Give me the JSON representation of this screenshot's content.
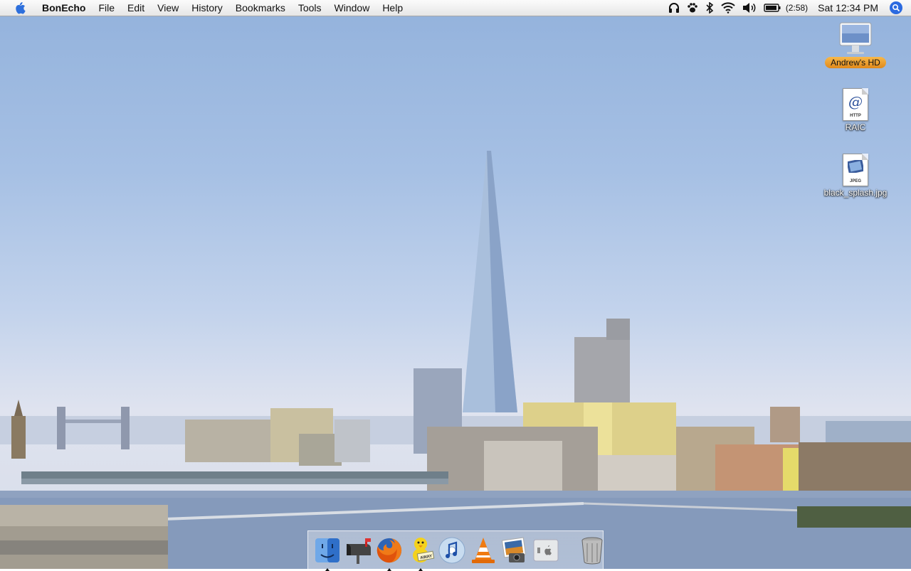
{
  "menubar": {
    "app_name": "BonEcho",
    "items": [
      "File",
      "Edit",
      "View",
      "History",
      "Bookmarks",
      "Tools",
      "Window",
      "Help"
    ],
    "battery_time": "(2:58)",
    "clock": "Sat 12:34 PM",
    "status_icons": [
      "headphones-icon",
      "growl-paw-icon",
      "bluetooth-icon",
      "wifi-icon",
      "volume-icon",
      "battery-icon"
    ]
  },
  "desktop": {
    "icons": [
      {
        "label": "Andrew's HD",
        "icon": "imac-icon",
        "selected": true
      },
      {
        "label": "RAIC",
        "icon": "http-location-icon",
        "badge": "HTTP"
      },
      {
        "label": "black_splash.jpg",
        "icon": "jpeg-file-icon",
        "badge": "JPEG"
      }
    ]
  },
  "dock": {
    "items": [
      {
        "icon": "finder-icon",
        "running": true
      },
      {
        "icon": "mail-icon",
        "running": false
      },
      {
        "icon": "firefox-icon",
        "running": true
      },
      {
        "icon": "adium-icon",
        "running": true,
        "badge": "AWAY"
      },
      {
        "icon": "itunes-icon",
        "running": false
      },
      {
        "icon": "vlc-icon",
        "running": false
      },
      {
        "icon": "iphoto-icon",
        "running": false
      },
      {
        "icon": "boot-camp-icon",
        "running": false
      },
      {
        "icon": "trash-icon",
        "running": false
      }
    ]
  },
  "colors": {
    "selection": "#f0a030",
    "spotlight": "#2b6ae0",
    "sky": "#a6c0e4",
    "water": "#8fa2c0"
  }
}
